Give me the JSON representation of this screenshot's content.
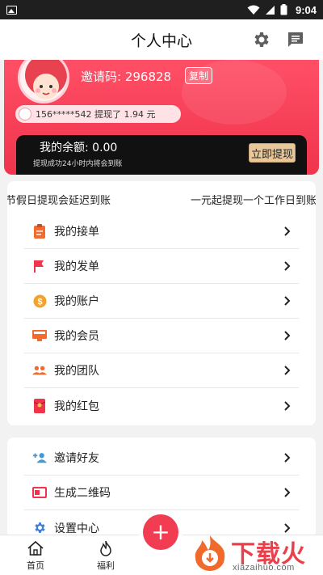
{
  "status_bar": {
    "time": "9:04"
  },
  "header": {
    "title": "个人中心"
  },
  "profile": {
    "invite_label": "邀请码:",
    "invite_code": "296828",
    "copy_label": "复制",
    "ticker_text": "156*****542 提现了 1.94 元",
    "balance_text": "我的余额: 0.00",
    "balance_note": "提现成功24小时内将会到账",
    "withdraw_label": "立即提现"
  },
  "notice": {
    "left": "节假日提现会延迟到账",
    "right": "一元起提现一个工作日到账"
  },
  "menu1": [
    {
      "label": "我的接单",
      "icon": "clipboard-icon"
    },
    {
      "label": "我的发单",
      "icon": "flag-icon"
    },
    {
      "label": "我的账户",
      "icon": "dollar-coin-icon"
    },
    {
      "label": "我的会员",
      "icon": "monitor-icon"
    },
    {
      "label": "我的团队",
      "icon": "group-icon"
    },
    {
      "label": "我的红包",
      "icon": "red-envelope-icon"
    }
  ],
  "menu2": [
    {
      "label": "邀请好友",
      "icon": "add-person-icon"
    },
    {
      "label": "生成二维码",
      "icon": "card-icon"
    },
    {
      "label": "设置中心",
      "icon": "gear-icon"
    }
  ],
  "bottom_nav": {
    "home_label": "首页",
    "fuli_label": "福利",
    "fab_symbol": "+"
  },
  "watermark": {
    "text": "下载火",
    "url": "xiazaihuo.com"
  },
  "colors": {
    "brand_red": "#f23c52",
    "orange_icon": "#f26a2e",
    "blue_icon": "#3f7fd6",
    "gold_button": "#e8c89a"
  }
}
